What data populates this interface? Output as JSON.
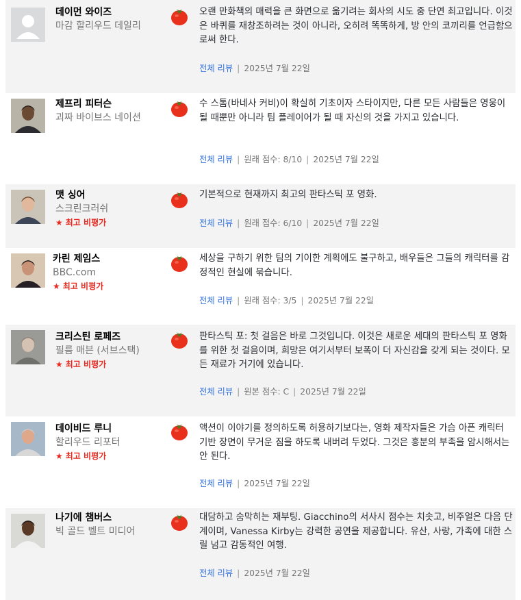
{
  "labels": {
    "full_review": "전체 리뷰",
    "top_critic": "최고 비평가",
    "separator": "|"
  },
  "reviews": [
    {
      "critic": "데이먼 와이즈",
      "publication": "마감 할리우드 데일리",
      "top_critic": false,
      "quote": "오랜 만화책의 매력을 큰 화면으로 옮기려는 회사의 시도 중 단연 최고입니다. 이것은 바퀴를 재창조하려는 것이 아니라, 오히려 똑똑하게, 방 안의 코끼리를 언급함으로써 한다.",
      "score": "",
      "date": "2025년 7월 22일",
      "avatar": "placeholder-avatar"
    },
    {
      "critic": "제프리 피터슨",
      "publication": "괴짜 바이브스 네이션",
      "top_critic": false,
      "quote": "수 스톰(바네사 커비)이 확실히 기초이자 스타이지만, 다른 모든 사람들은 영웅이 될 때뿐만 아니라 팀 플레이어가 될 때 자신의 것을 가지고 있습니다.",
      "score": "원래 점수: 8/10",
      "date": "2025년 7월 22일",
      "avatar": "critic-photo"
    },
    {
      "critic": "맷 싱어",
      "publication": "스크린크러쉬",
      "top_critic": true,
      "quote": "기본적으로 현재까지 최고의 판타스틱 포 영화.",
      "score": "원래 점수: 6/10",
      "date": "2025년 7월 22일",
      "avatar": "critic-photo"
    },
    {
      "critic": "카린 제임스",
      "publication": "BBC.com",
      "top_critic": true,
      "quote": "세상을 구하기 위한 팀의 기이한 계획에도 불구하고, 배우들은 그들의 캐릭터를 감정적인 현실에 묶습니다.",
      "score": "원래 점수: 3/5",
      "date": "2025년 7월 22일",
      "avatar": "critic-photo"
    },
    {
      "critic": "크리스틴 로페즈",
      "publication": "필름 매븐 (서브스택)",
      "top_critic": true,
      "quote": "판타스틱 포: 첫 걸음은 바로 그것입니다. 이것은 새로운 세대의 판타스틱 포 영화를 위한 첫 걸음이며, 희망은 여기서부터 보폭이 더 자신감을 갖게 되는 것이다. 모든 재료가 거기에 있습니다.",
      "score": "원본 점수: C",
      "date": "2025년 7월 22일",
      "avatar": "critic-photo"
    },
    {
      "critic": "데이비드 루니",
      "publication": "할리우드 리포터",
      "top_critic": true,
      "quote": "액션이 이야기를 정의하도록 허용하기보다는, 영화 제작자들은 가슴 아픈 캐릭터 기반 장면이 무거운 짐을 하도록 내버려 두었다. 그것은 흥분의 부족을 암시해서는 안 된다.",
      "score": "",
      "date": "2025년 7월 22일",
      "avatar": "critic-photo"
    },
    {
      "critic": "나기에 챔버스",
      "publication": "빅 골드 벨트 미디어",
      "top_critic": false,
      "quote": "대담하고 숨막히는 재부팅. Giacchino의 서사시 점수는 치솟고, 비주얼은 다음 단계이며, Vanessa Kirby는 강력한 공연을 제공합니다. 유산, 사랑, 가족에 대한 스릴 넘고 감동적인 여행.",
      "score": "",
      "date": "2025년 7월 22일",
      "avatar": "critic-photo"
    }
  ],
  "colors": {
    "row_shaded": "#f3f3f3",
    "link": "#3976dc",
    "top_critic": "#e6281e",
    "tomato": "#e8301c"
  }
}
